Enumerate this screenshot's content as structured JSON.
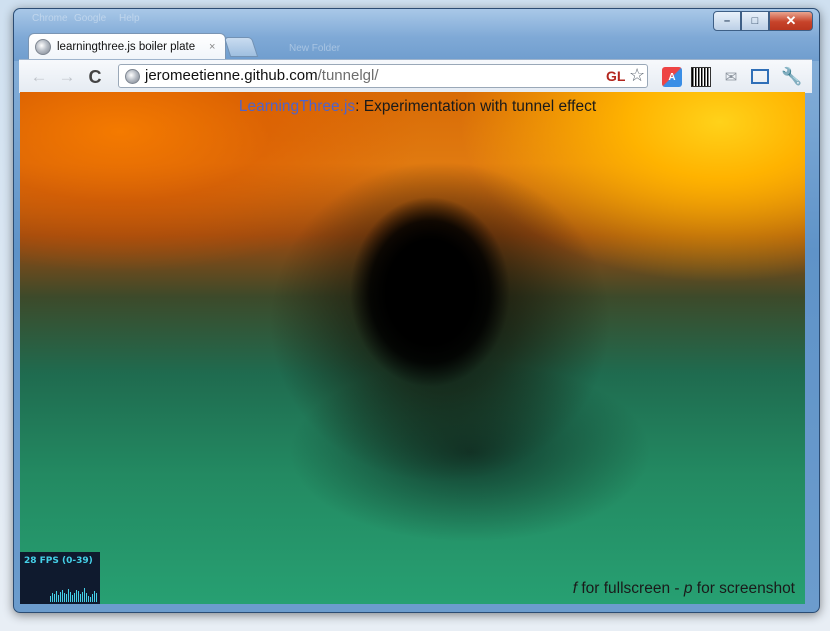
{
  "browser": {
    "ghost_title_text": [
      "Chrome",
      "Google",
      "Help",
      "New Folder"
    ],
    "tab": {
      "title": "learningthree.js boiler plate",
      "close_glyph": "×"
    },
    "window_controls": {
      "minimize_glyph": "–",
      "maximize_glyph": "□",
      "close_glyph": "✕"
    },
    "toolbar": {
      "back_glyph": "←",
      "forward_glyph": "→",
      "reload_glyph": "C",
      "url_host": "jeromeetienne.github.com",
      "url_path": "/tunnelgl/",
      "gl_badge": "GL",
      "star_glyph": "☆",
      "extensions": [
        "translate-icon",
        "qr-code-icon",
        "mail-icon",
        "screenshot-icon",
        "wrench-icon"
      ],
      "translate_glyph": "A",
      "mail_glyph": "✉",
      "wrench_glyph": "🔧"
    }
  },
  "page": {
    "title_link": "LearningThree.js",
    "title_rest": ": Experimentation with tunnel effect",
    "hint": {
      "key_f": "f",
      "text_f": " for fullscreen - ",
      "key_p": "p",
      "text_p": " for screenshot"
    },
    "fps_meter": {
      "label": "28 FPS (0-39)",
      "color": "#45d0e8"
    }
  },
  "colors": {
    "link": "#4f63c9",
    "gl_badge": "#b3261e"
  }
}
